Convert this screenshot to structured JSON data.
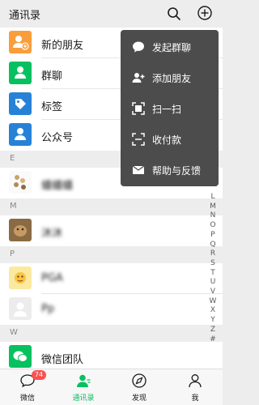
{
  "header": {
    "title": "通讯录"
  },
  "functions": [
    {
      "label": "新的朋友",
      "icon": "new-friends-icon",
      "color": "#fa9d3b"
    },
    {
      "label": "群聊",
      "icon": "group-chat-icon",
      "color": "#07c160"
    },
    {
      "label": "标签",
      "icon": "tag-icon",
      "color": "#2782d7"
    },
    {
      "label": "公众号",
      "icon": "official-account-icon",
      "color": "#2782d7"
    }
  ],
  "sections": [
    {
      "letter": "E",
      "contacts": [
        {
          "name": "蟠蟠蟠",
          "blurred": true
        }
      ]
    },
    {
      "letter": "M",
      "contacts": [
        {
          "name": "沐沐",
          "blurred": true
        }
      ]
    },
    {
      "letter": "P",
      "contacts": [
        {
          "name": "PGA",
          "blurred": true
        },
        {
          "name": "Pp",
          "blurred": true
        }
      ]
    },
    {
      "letter": "W",
      "contacts": [
        {
          "name": "微信团队",
          "blurred": false
        }
      ]
    }
  ],
  "alphabet": [
    "L",
    "M",
    "N",
    "O",
    "P",
    "Q",
    "R",
    "S",
    "T",
    "U",
    "V",
    "W",
    "X",
    "Y",
    "Z",
    "#"
  ],
  "popup_menu": [
    {
      "label": "发起群聊",
      "icon": "chat-bubble-icon"
    },
    {
      "label": "添加朋友",
      "icon": "add-friend-icon"
    },
    {
      "label": "扫一扫",
      "icon": "scan-icon"
    },
    {
      "label": "收付款",
      "icon": "payment-icon"
    },
    {
      "label": "帮助与反馈",
      "icon": "help-mail-icon"
    }
  ],
  "tabbar": [
    {
      "label": "微信",
      "badge": "74",
      "active": false
    },
    {
      "label": "通讯录",
      "badge": "",
      "active": true
    },
    {
      "label": "发现",
      "badge": "",
      "active": false
    },
    {
      "label": "我",
      "badge": "",
      "active": false
    }
  ],
  "colors": {
    "accent": "#07c160",
    "badge": "#fa5151",
    "menu_bg": "#4c4c4c"
  }
}
